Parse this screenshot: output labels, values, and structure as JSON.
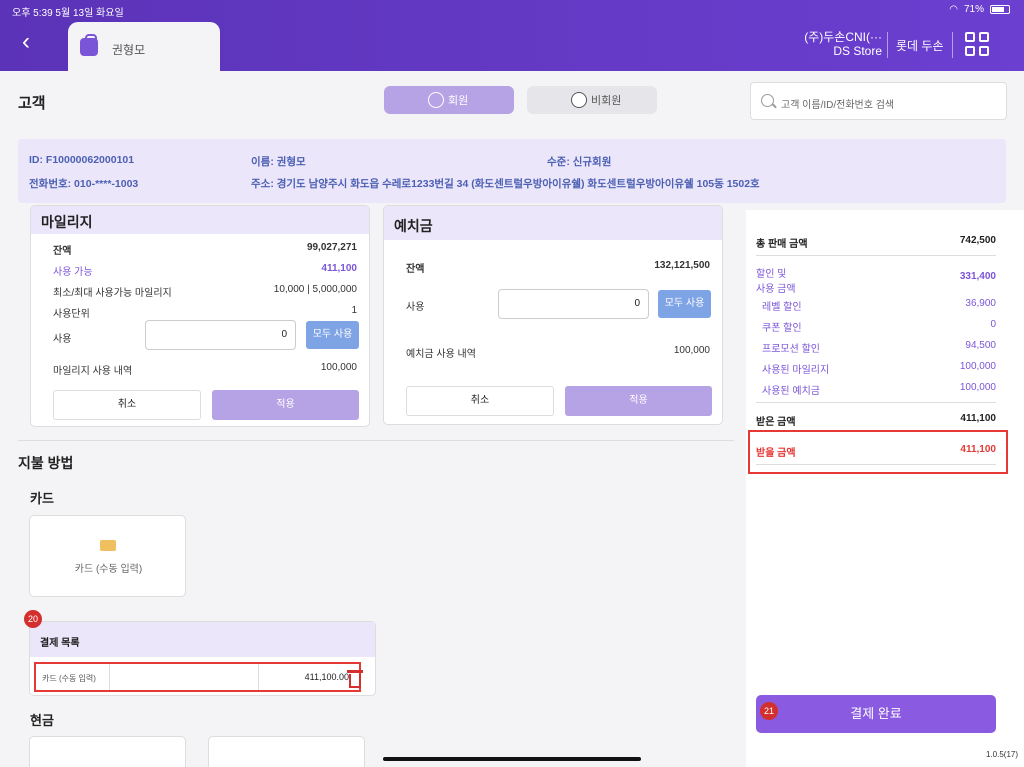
{
  "status": {
    "time": "오후 5:39   5월 13일 화요일",
    "battery": "71%"
  },
  "header": {
    "tab_label": "권형모",
    "company_line1": "(주)두손CNI(···",
    "company_line2": "DS Store",
    "store": "롯데 두손"
  },
  "customer": {
    "title": "고객",
    "member_label": "회원",
    "nonmember_label": "비회원",
    "search_placeholder": "고객 이름/ID/전화번호 검색",
    "id": "ID: F10000062000101",
    "name": "이름: 권형모",
    "level": "수준: 신규회원",
    "phone": "전화번호: 010-****-1003",
    "address": "주소: 경기도 남양주시 화도읍 수레로1233번길 34  (화도센트럴우방아이유쉘) 화도센트럴우방아이유쉘 105동 1502호"
  },
  "mileage": {
    "title": "마일리지",
    "balance_label": "잔액",
    "balance": "99,027,271",
    "available_label": "사용 가능",
    "available": "411,100",
    "minmax_label": "최소/최대 사용가능 마일리지",
    "minmax": "10,000 | 5,000,000",
    "unit_label": "사용단위",
    "unit": "1",
    "use_label": "사용",
    "use_value": "0",
    "use_all": "모두 사용",
    "history_label": "마일리지 사용 내역",
    "history": "100,000",
    "cancel": "취소",
    "apply": "적용"
  },
  "deposit": {
    "title": "예치금",
    "balance_label": "잔액",
    "balance": "132,121,500",
    "use_label": "사용",
    "use_value": "0",
    "use_all": "모두 사용",
    "history_label": "예치금 사용 내역",
    "history": "100,000",
    "cancel": "취소",
    "apply": "적용"
  },
  "payment": {
    "title": "지불 방법",
    "card_section": "카드",
    "card_manual": "카드 (수동 입력)",
    "list_title": "결제 목록",
    "list_badge": "20",
    "row_method": "카드 (수동 입력)",
    "row_amount": "411,100.00",
    "cash_section": "현금"
  },
  "summary": {
    "total_label": "총 판매 금액",
    "total": "742,500",
    "discount_label_1": "할인 및",
    "discount_label_2": "사용 금액",
    "discount": "331,400",
    "level_discount_label": "레벨 할인",
    "level_discount": "36,900",
    "coupon_label": "쿠폰 할인",
    "coupon": "0",
    "promo_label": "프로모션 할인",
    "promo": "94,500",
    "used_mileage_label": "사용된 마일리지",
    "used_mileage": "100,000",
    "used_deposit_label": "사용된 예치금",
    "used_deposit": "100,000",
    "received_label": "받은 금액",
    "received": "411,100",
    "to_receive_label": "받을 금액",
    "to_receive": "411,100",
    "complete": "결제 완료",
    "complete_badge": "21",
    "version": "1.0.5(17)"
  },
  "colors": {
    "brand": "#6b3fd0",
    "highlight": "#e53935",
    "accent_text": "#7b55d8"
  }
}
